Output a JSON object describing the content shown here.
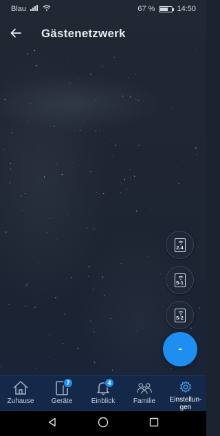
{
  "status_bar": {
    "carrier": "Blau",
    "battery_percent": "67 %",
    "battery_level": 0.67,
    "time": "14:50"
  },
  "app_bar": {
    "back_icon": "arrow-left-icon",
    "title": "Gästenetzwerk"
  },
  "band_buttons": [
    {
      "label": "2.4",
      "icon": "wifi-band-icon"
    },
    {
      "label": "5-1",
      "icon": "wifi-band-icon"
    },
    {
      "label": "5-2",
      "icon": "wifi-band-icon"
    }
  ],
  "fab": {
    "label": "-"
  },
  "bottom_nav": {
    "items": [
      {
        "label": "Zuhause",
        "icon": "home-icon",
        "badge": ""
      },
      {
        "label": "Geräte",
        "icon": "devices-icon",
        "badge": "7"
      },
      {
        "label": "Einblick",
        "icon": "bell-icon",
        "badge": "4"
      },
      {
        "label": "Familie",
        "icon": "family-icon",
        "badge": ""
      },
      {
        "label": "Einstellun-\ngen",
        "icon": "settings-gear-icon",
        "badge": "",
        "active": true
      }
    ]
  },
  "colors": {
    "accent": "#1e8ff0",
    "nav_background": "#14294a",
    "active": "#4aa3f5"
  }
}
